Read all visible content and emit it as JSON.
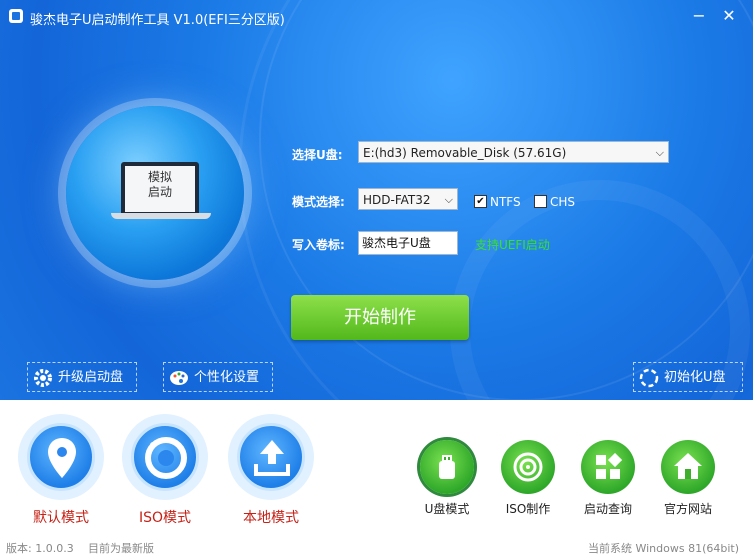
{
  "window": {
    "title": "骏杰电子U启动制作工具 V1.0(EFI三分区版)",
    "minimize_glyph": "−",
    "close_glyph": "✕"
  },
  "simulate": {
    "line1": "模拟",
    "line2": "启动"
  },
  "form": {
    "disk_label": "选择U盘:",
    "disk_value": "E:(hd3) Removable_Disk (57.61G)",
    "mode_label": "模式选择:",
    "mode_value": "HDD-FAT32",
    "ntfs_label": "NTFS",
    "ntfs_checked": true,
    "chs_label": "CHS",
    "chs_checked": false,
    "volume_label": "写入卷标:",
    "volume_value": "骏杰电子U盘",
    "uefi_text": "支持UEFI启动"
  },
  "start_button": "开始制作",
  "tools": {
    "upgrade": "升级启动盘",
    "personalize": "个性化设置",
    "init": "初始化U盘"
  },
  "modes": [
    {
      "label": "默认模式"
    },
    {
      "label": "ISO模式"
    },
    {
      "label": "本地模式"
    }
  ],
  "actions": [
    {
      "label": "U盘模式"
    },
    {
      "label": "ISO制作"
    },
    {
      "label": "启动查询"
    },
    {
      "label": "官方网站"
    }
  ],
  "status": {
    "version": "版本: 1.0.0.3",
    "update": "目前为最新版",
    "system": "当前系统 Windows 81(64bit)"
  },
  "colors": {
    "primary_blue": "#1a73e0",
    "green": "#52b81c",
    "mode_text": "#c62116",
    "uefi_green": "#39e12a"
  }
}
